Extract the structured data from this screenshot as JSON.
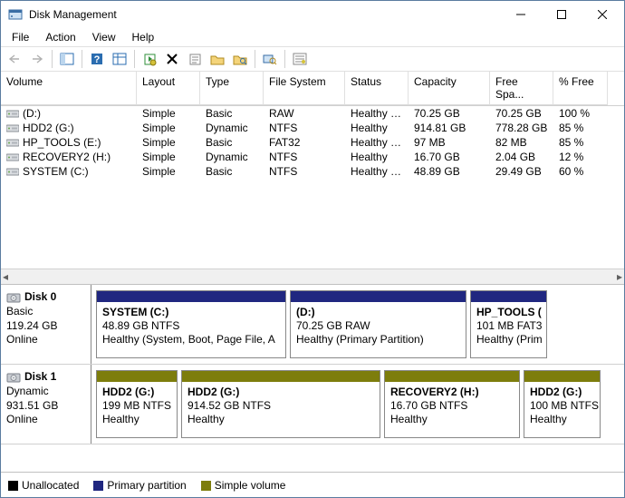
{
  "window": {
    "title": "Disk Management"
  },
  "menu": {
    "file": "File",
    "action": "Action",
    "view": "View",
    "help": "Help"
  },
  "columns": {
    "volume": "Volume",
    "layout": "Layout",
    "type": "Type",
    "fs": "File System",
    "status": "Status",
    "capacity": "Capacity",
    "free": "Free Spa...",
    "pct": "% Free"
  },
  "volumes": [
    {
      "name": "(D:)",
      "layout": "Simple",
      "type": "Basic",
      "fs": "RAW",
      "status": "Healthy (P...",
      "capacity": "70.25 GB",
      "free": "70.25 GB",
      "pct": "100 %"
    },
    {
      "name": "HDD2 (G:)",
      "layout": "Simple",
      "type": "Dynamic",
      "fs": "NTFS",
      "status": "Healthy",
      "capacity": "914.81 GB",
      "free": "778.28 GB",
      "pct": "85 %"
    },
    {
      "name": "HP_TOOLS (E:)",
      "layout": "Simple",
      "type": "Basic",
      "fs": "FAT32",
      "status": "Healthy (P...",
      "capacity": "97 MB",
      "free": "82 MB",
      "pct": "85 %"
    },
    {
      "name": "RECOVERY2 (H:)",
      "layout": "Simple",
      "type": "Dynamic",
      "fs": "NTFS",
      "status": "Healthy",
      "capacity": "16.70 GB",
      "free": "2.04 GB",
      "pct": "12 %"
    },
    {
      "name": "SYSTEM (C:)",
      "layout": "Simple",
      "type": "Basic",
      "fs": "NTFS",
      "status": "Healthy (S...",
      "capacity": "48.89 GB",
      "free": "29.49 GB",
      "pct": "60 %"
    }
  ],
  "disks": [
    {
      "label": "Disk 0",
      "type": "Basic",
      "size": "119.24 GB",
      "state": "Online",
      "parts": [
        {
          "stripe": "primary",
          "title": "SYSTEM  (C:)",
          "line2": "48.89 GB NTFS",
          "line3": "Healthy (System, Boot, Page File, A",
          "flex": 210
        },
        {
          "stripe": "primary",
          "title": " (D:)",
          "line2": "70.25 GB RAW",
          "line3": "Healthy (Primary Partition)",
          "flex": 195
        },
        {
          "stripe": "primary",
          "title": "HP_TOOLS  (",
          "line2": "101 MB FAT3",
          "line3": "Healthy (Prim",
          "flex": 85
        }
      ]
    },
    {
      "label": "Disk 1",
      "type": "Dynamic",
      "size": "931.51 GB",
      "state": "Online",
      "parts": [
        {
          "stripe": "simple",
          "title": "HDD2  (G:)",
          "line2": "199 MB NTFS",
          "line3": "Healthy",
          "flex": 90
        },
        {
          "stripe": "simple",
          "title": "HDD2  (G:)",
          "line2": "914.52 GB NTFS",
          "line3": "Healthy",
          "flex": 220
        },
        {
          "stripe": "simple",
          "title": "RECOVERY2  (H:)",
          "line2": "16.70 GB NTFS",
          "line3": "Healthy",
          "flex": 150
        },
        {
          "stripe": "simple",
          "title": "HDD2  (G:)",
          "line2": "100 MB NTFS",
          "line3": "Healthy",
          "flex": 85
        }
      ]
    }
  ],
  "legend": {
    "unalloc": "Unallocated",
    "primary": "Primary partition",
    "simple": "Simple volume"
  }
}
